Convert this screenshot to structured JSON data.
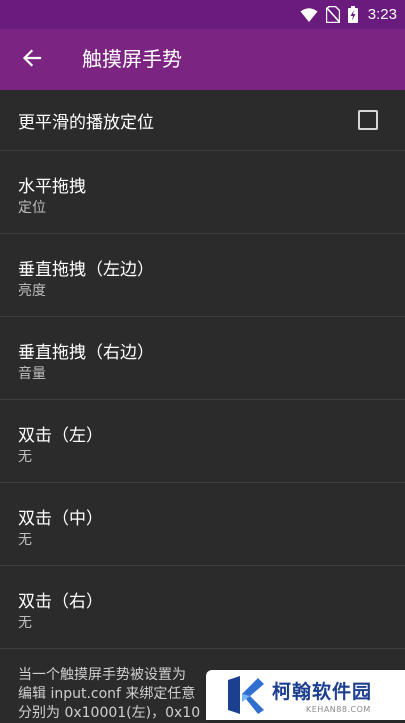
{
  "status_bar": {
    "time": "3:23",
    "icons": [
      "wifi-icon",
      "sim-off-icon",
      "battery-charging-icon"
    ]
  },
  "app_bar": {
    "back_icon": "arrow-left-icon",
    "title": "触摸屏手势"
  },
  "preferences": [
    {
      "id": "smooth-seek",
      "title": "更平滑的播放定位",
      "checked": false
    },
    {
      "id": "horizontal-drag",
      "title": "水平拖拽",
      "summary": "定位"
    },
    {
      "id": "vertical-drag-left",
      "title": "垂直拖拽（左边）",
      "summary": "亮度"
    },
    {
      "id": "vertical-drag-right",
      "title": "垂直拖拽（右边）",
      "summary": "音量"
    },
    {
      "id": "double-tap-left",
      "title": "双击（左）",
      "summary": "无"
    },
    {
      "id": "double-tap-center",
      "title": "双击（中）",
      "summary": "无"
    },
    {
      "id": "double-tap-right",
      "title": "双击（右）",
      "summary": "无"
    }
  ],
  "footer_note": {
    "lines": [
      "当一个触摸屏手势被设置为",
      "编辑 input.conf 来绑定任意",
      "分别为 0x10001(左)，0x10"
    ]
  },
  "watermark": {
    "name": "柯翰软件园",
    "url": "KEHAN88.COM"
  },
  "colors": {
    "status_bar": "#6a1b7e",
    "app_bar": "#7b2482",
    "background": "#2b2b2b",
    "divider": "#3f3f3f",
    "watermark_blue": "#1d3f8f"
  }
}
